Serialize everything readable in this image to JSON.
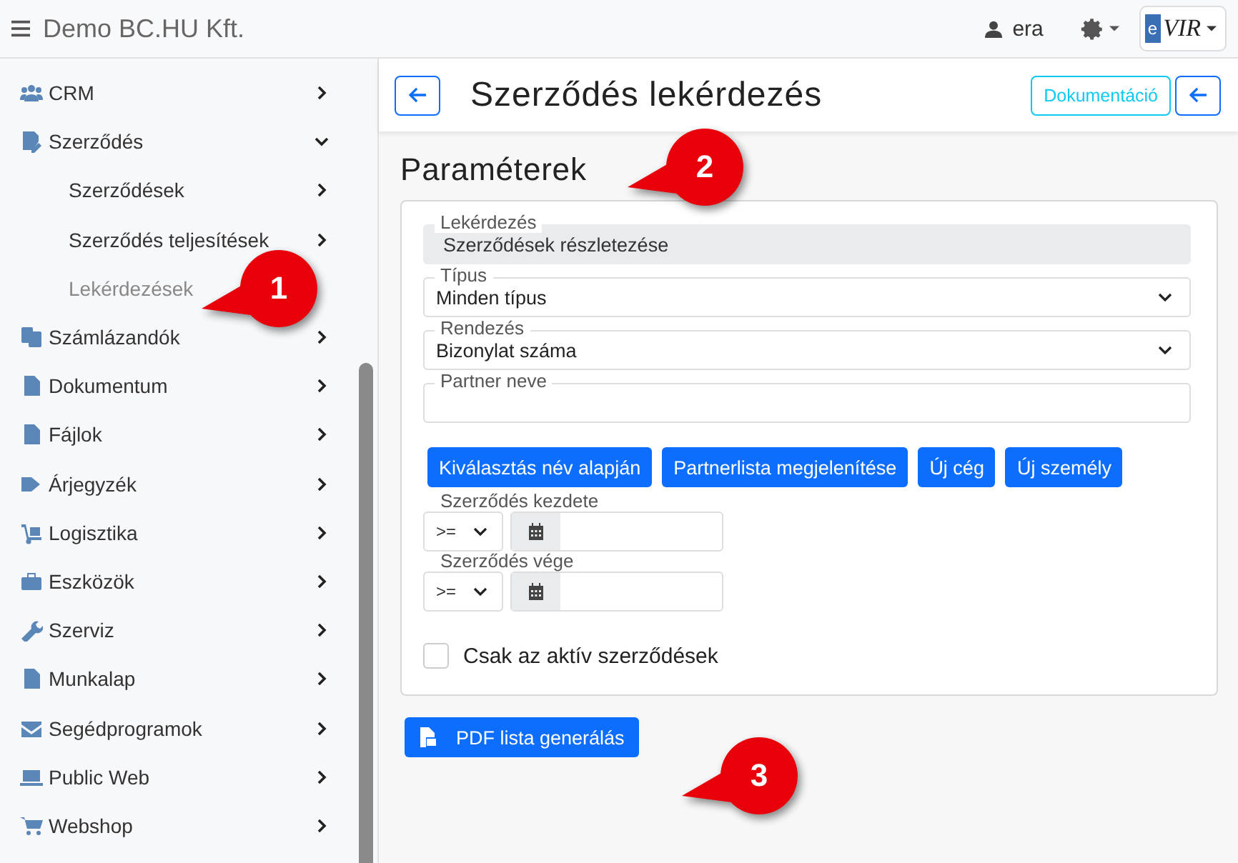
{
  "topbar": {
    "company": "Demo BC.HU Kft.",
    "user": "era",
    "logo": {
      "letter": "e",
      "text": "VIR"
    }
  },
  "sidebar": {
    "items": [
      {
        "label": "CRM",
        "expanded": false
      },
      {
        "label": "Szerződés",
        "expanded": true,
        "children": [
          {
            "label": "Szerződések",
            "selected": false,
            "chevron": true
          },
          {
            "label": "Szerződés teljesítések",
            "selected": false,
            "chevron": true
          },
          {
            "label": "Lekérdezések",
            "selected": true,
            "chevron": false
          }
        ]
      },
      {
        "label": "Számlázandók",
        "expanded": false
      },
      {
        "label": "Dokumentum",
        "expanded": false
      },
      {
        "label": "Fájlok",
        "expanded": false
      },
      {
        "label": "Árjegyzék",
        "expanded": false
      },
      {
        "label": "Logisztika",
        "expanded": false
      },
      {
        "label": "Eszközök",
        "expanded": false
      },
      {
        "label": "Szerviz",
        "expanded": false
      },
      {
        "label": "Munkalap",
        "expanded": false
      },
      {
        "label": "Segédprogramok",
        "expanded": false
      },
      {
        "label": "Public Web",
        "expanded": false
      },
      {
        "label": "Webshop",
        "expanded": false
      }
    ]
  },
  "page": {
    "title": "Szerződés lekérdezés",
    "doc_button": "Dokumentáció",
    "section": "Paraméterek",
    "fields": [
      {
        "kind": "readonly",
        "label": "Lekérdezés",
        "value": "Szerződések részletezése"
      },
      {
        "kind": "select",
        "label": "Típus",
        "value": "Minden típus"
      },
      {
        "kind": "select",
        "label": "Rendezés",
        "value": "Bizonylat száma"
      },
      {
        "kind": "text",
        "label": "Partner neve"
      }
    ],
    "partner_buttons": [
      "Kiválasztás név alapján",
      "Partnerlista megjelenítése",
      "Új cég",
      "Új személy"
    ],
    "date_filters": [
      {
        "label": "Szerződés kezdete",
        "operator": ">="
      },
      {
        "label": "Szerződés vége",
        "operator": ">="
      }
    ],
    "checkbox": {
      "label": "Csak az aktív szerződések",
      "checked": false
    },
    "pdf_button": "PDF lista generálás"
  },
  "callouts": [
    "1",
    "2",
    "3"
  ]
}
